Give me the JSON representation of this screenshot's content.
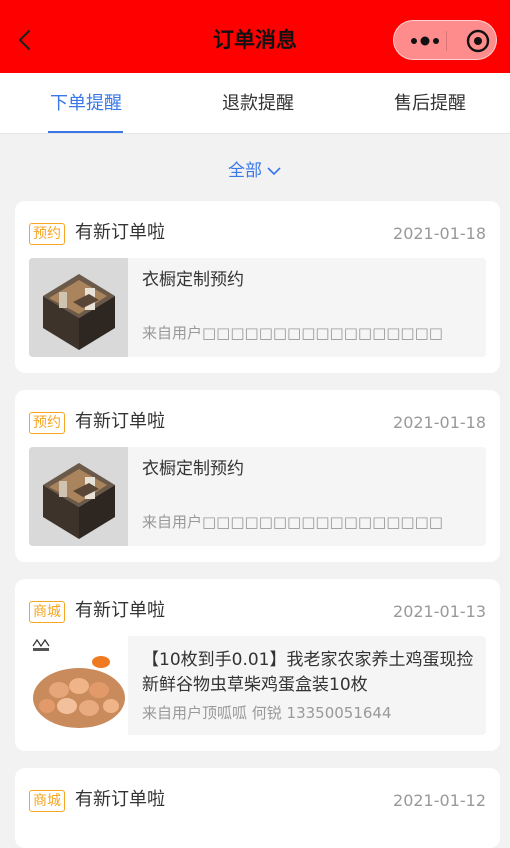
{
  "header": {
    "title": "订单消息",
    "back_icon": "chevron-left-icon",
    "more_icon": "more-dots-icon",
    "close_icon": "target-icon",
    "bg_color": "#ff0000"
  },
  "tabs": [
    {
      "label": "下单提醒",
      "active": true
    },
    {
      "label": "退款提醒",
      "active": false
    },
    {
      "label": "售后提醒",
      "active": false
    }
  ],
  "filter": {
    "label": "全部",
    "icon": "chevron-down-icon"
  },
  "accent_color": "#3a78e8",
  "tag_color": "#f5a623",
  "orders": [
    {
      "tag": "预约",
      "title": "有新订单啦",
      "date": "2021-01-18",
      "product_name": "衣橱定制预约",
      "from": "来自用户□□□□□□□□□□□□□□□□□"
    },
    {
      "tag": "预约",
      "title": "有新订单啦",
      "date": "2021-01-18",
      "product_name": "衣橱定制预约",
      "from": "来自用户□□□□□□□□□□□□□□□□□"
    },
    {
      "tag": "商城",
      "title": "有新订单啦",
      "date": "2021-01-13",
      "product_name": "【10枚到手0.01】我老家农家养土鸡蛋现捡新鲜谷物虫草柴鸡蛋盒装10枚",
      "from": "来自用户顶呱呱 何锐 13350051644"
    },
    {
      "tag": "商城",
      "title": "有新订单啦",
      "date": "2021-01-12"
    }
  ]
}
